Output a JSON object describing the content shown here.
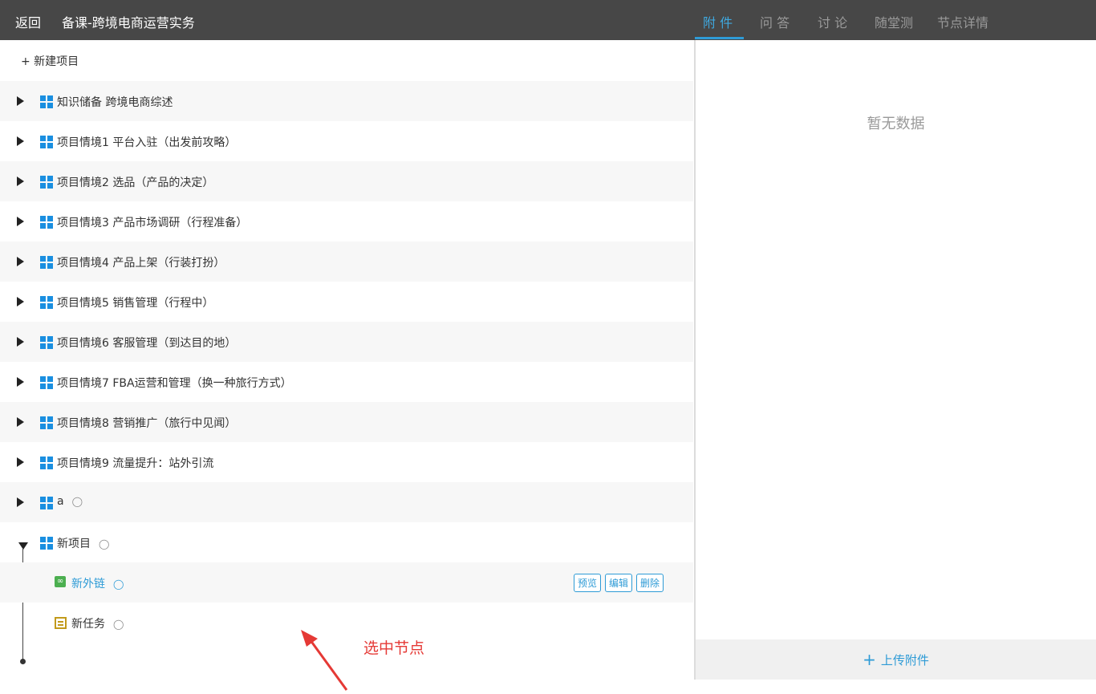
{
  "header": {
    "back_label": "返回",
    "course_title": "备课-跨境电商运营实务",
    "tabs": [
      {
        "label": "附 件",
        "active": true
      },
      {
        "label": "问 答",
        "active": false
      },
      {
        "label": "讨 论",
        "active": false
      },
      {
        "label": "随堂测",
        "active": false
      },
      {
        "label": "节点详情",
        "active": false
      }
    ]
  },
  "tree": {
    "new_project_label": "+ 新建项目",
    "projects": [
      {
        "label": "知识储备 跨境电商综述"
      },
      {
        "label": "项目情境1 平台入驻（出发前攻略）"
      },
      {
        "label": "项目情境2 选品（产品的决定）"
      },
      {
        "label": "项目情境3 产品市场调研（行程准备）"
      },
      {
        "label": "项目情境4 产品上架（行装打扮）"
      },
      {
        "label": "项目情境5 销售管理（行程中）"
      },
      {
        "label": "项目情境6 客服管理（到达目的地）"
      },
      {
        "label": "项目情境7 FBA运营和管理（换一种旅行方式）"
      },
      {
        "label": "项目情境8 营销推广（旅行中见闻）"
      },
      {
        "label": "项目情境9 流量提升：站外引流"
      },
      {
        "label": "a"
      },
      {
        "label": "新项目",
        "expanded": true
      }
    ],
    "children": [
      {
        "label": "新外链",
        "type": "link",
        "selected": true
      },
      {
        "label": "新任务",
        "type": "task",
        "selected": false
      }
    ],
    "child_actions": {
      "preview": "预览",
      "edit": "编辑",
      "delete": "删除"
    },
    "owner_icon": "person-icon"
  },
  "annotation": {
    "text": "选中节点",
    "color": "#e53935"
  },
  "side_panel": {
    "empty_text": "暂无数据",
    "upload_label": "上传附件"
  },
  "colors": {
    "accent": "#2e9bd6",
    "topbar": "#474747",
    "icon_blue": "#1a8fe0"
  }
}
